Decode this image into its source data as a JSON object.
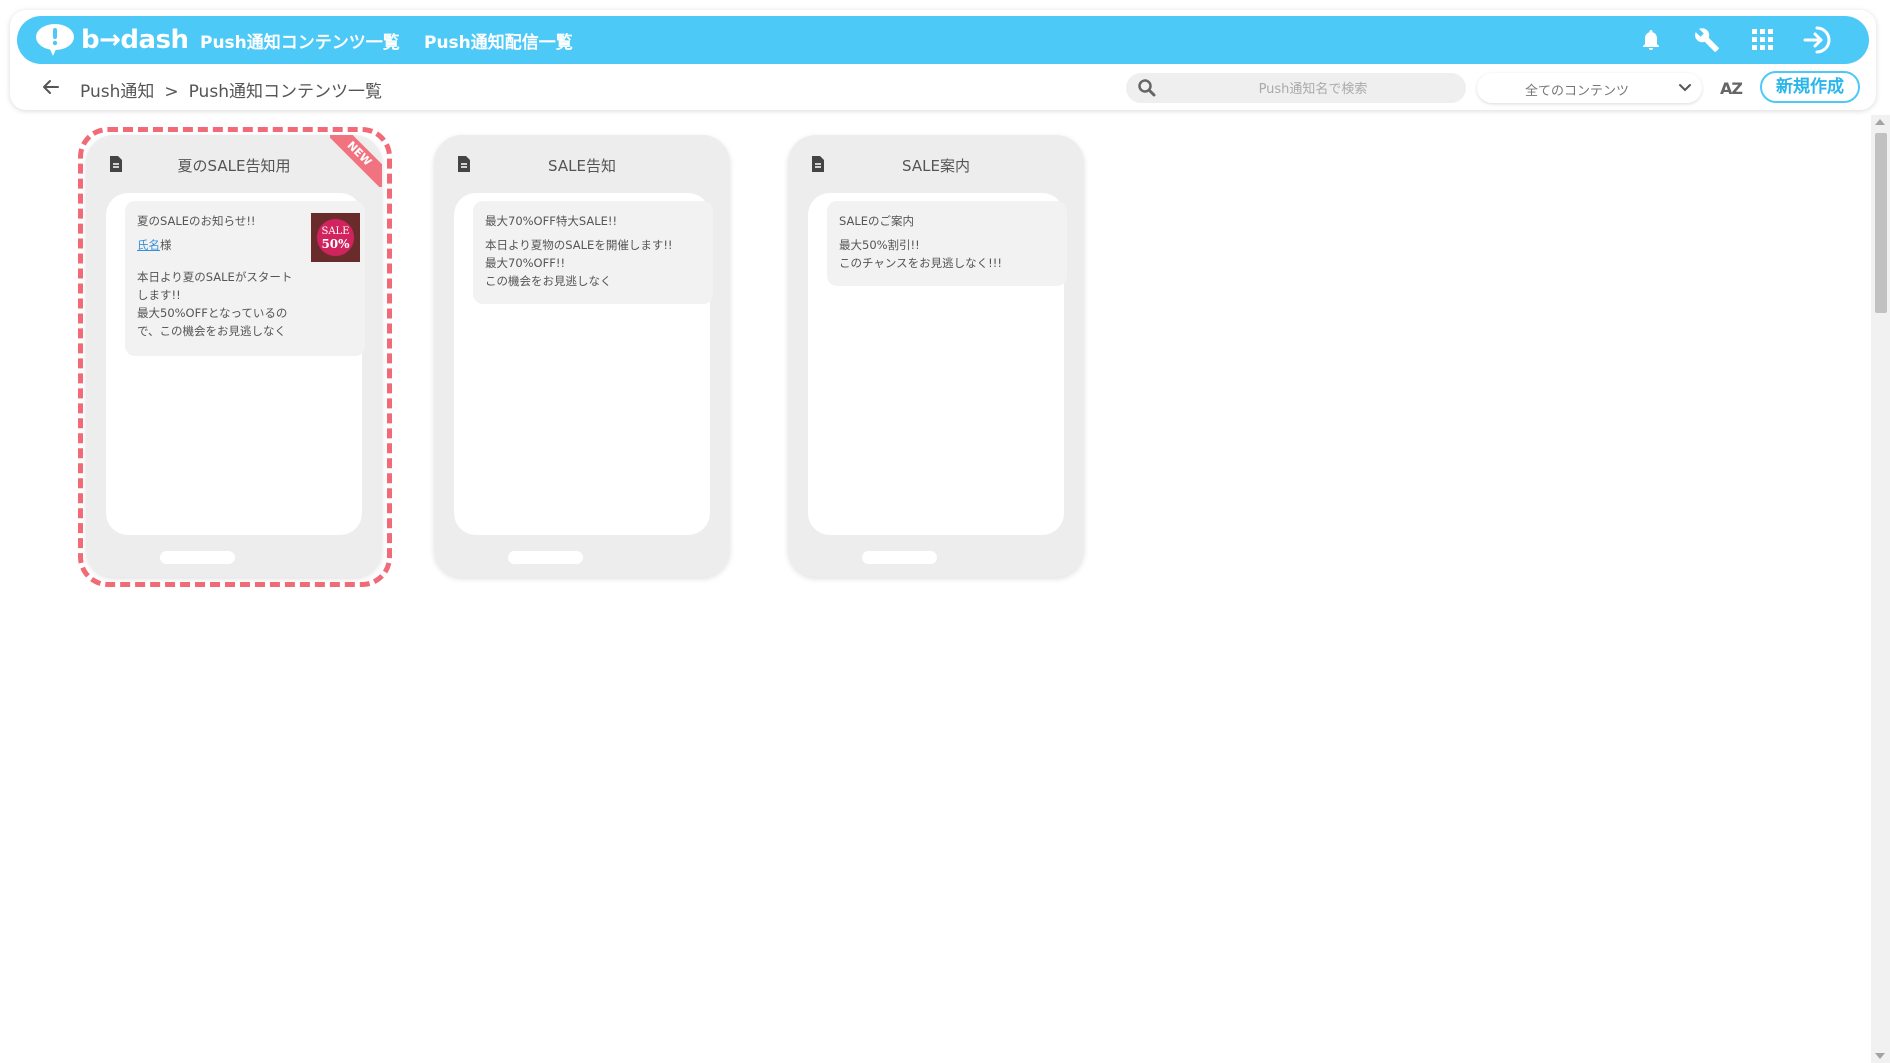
{
  "brand": {
    "logo_text": "b→dash",
    "accent": "#4cc9f7"
  },
  "nav": {
    "links": [
      "Push通知コンテンツ一覧",
      "Push通知配信一覧"
    ],
    "icons": [
      "bell-icon",
      "wrench-icon",
      "grid-icon",
      "logout-icon"
    ]
  },
  "breadcrumb": {
    "root": "Push通知",
    "separator": ">",
    "current": "Push通知コンテンツ一覧"
  },
  "search": {
    "placeholder": "Push通知名で検索",
    "value": ""
  },
  "filter": {
    "selected": "全てのコンテンツ"
  },
  "sort": {
    "label": "AZ"
  },
  "actions": {
    "new_label": "新規作成"
  },
  "cards": [
    {
      "title": "夏のSALE告知用",
      "badge": "NEW",
      "message_title": "夏のSALEのお知らせ!!",
      "name_tag": "氏名",
      "name_suffix": "様",
      "body": "本日より夏のSALEがスタート\nします!!\n最大50%OFFとなっているの\nで、この機会をお見逃しなく",
      "thumbnail": {
        "line1": "SALE",
        "line2": "50%"
      }
    },
    {
      "title": "SALE告知",
      "message_title": "最大70%OFF特大SALE!!",
      "body": "本日より夏物のSALEを開催します!!\n最大70%OFF!!\nこの機会をお見逃しなく"
    },
    {
      "title": "SALE案内",
      "message_title": "SALEのご案内",
      "body": "最大50%割引!!\nこのチャンスをお見逃しなく!!!"
    }
  ]
}
